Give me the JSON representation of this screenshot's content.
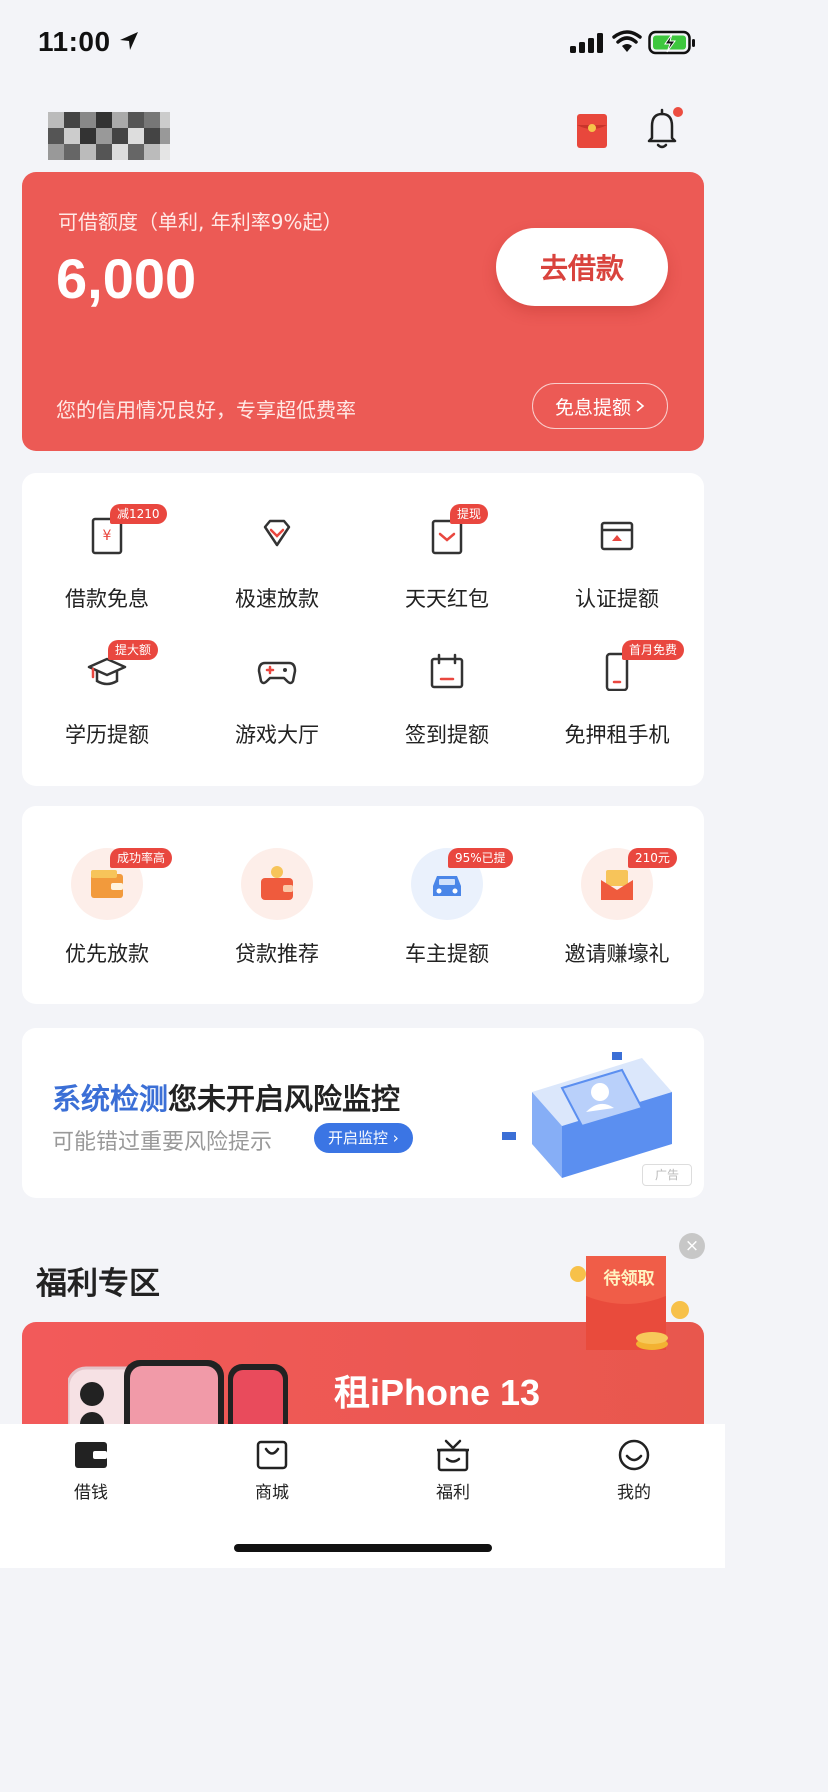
{
  "status_bar": {
    "time": "11:00"
  },
  "header": {
    "icons": [
      "red-packet-icon",
      "bell-icon"
    ],
    "colors": {
      "accent": "#ec5a55"
    }
  },
  "loan_card": {
    "limit_label": "可借额度（单利, 年利率9%起）",
    "limit_amount": "6,000",
    "borrow_button": "去借款",
    "credit_note": "您的信用情况良好，专享超低费率",
    "raise_button": "免息提额"
  },
  "services": [
    {
      "label": "借款免息",
      "tag": "减1210",
      "icon": "coupon-icon"
    },
    {
      "label": "极速放款",
      "tag": "",
      "icon": "diamond-icon"
    },
    {
      "label": "天天红包",
      "tag": "提现",
      "icon": "envelope-icon"
    },
    {
      "label": "认证提额",
      "tag": "",
      "icon": "card-upload-icon"
    },
    {
      "label": "学历提额",
      "tag": "提大额",
      "icon": "graduation-cap-icon"
    },
    {
      "label": "游戏大厅",
      "tag": "",
      "icon": "gamepad-icon"
    },
    {
      "label": "签到提额",
      "tag": "",
      "icon": "calendar-icon"
    },
    {
      "label": "免押租手机",
      "tag": "首月免费",
      "icon": "phone-icon"
    }
  ],
  "features": [
    {
      "label": "优先放款",
      "tag": "成功率高",
      "icon": "wallet-icon"
    },
    {
      "label": "贷款推荐",
      "tag": "",
      "icon": "purse-icon"
    },
    {
      "label": "车主提额",
      "tag": "95%已提",
      "icon": "car-icon"
    },
    {
      "label": "邀请赚壕礼",
      "tag": "210元",
      "icon": "gift-envelope-icon"
    }
  ],
  "ad": {
    "title_highlight": "系统检测",
    "title_rest": "您未开启风险监控",
    "subtitle": "可能错过重要风险提示",
    "button": "开启监控",
    "badge": "广告"
  },
  "welfare": {
    "title": "福利专区",
    "promo_text": "租iPhone 13",
    "float_label": "待领取"
  },
  "tabbar": [
    {
      "label": "借钱",
      "icon": "wallet-tab-icon"
    },
    {
      "label": "商城",
      "icon": "shopping-bag-icon"
    },
    {
      "label": "福利",
      "icon": "gift-box-icon"
    },
    {
      "label": "我的",
      "icon": "smile-icon"
    }
  ]
}
